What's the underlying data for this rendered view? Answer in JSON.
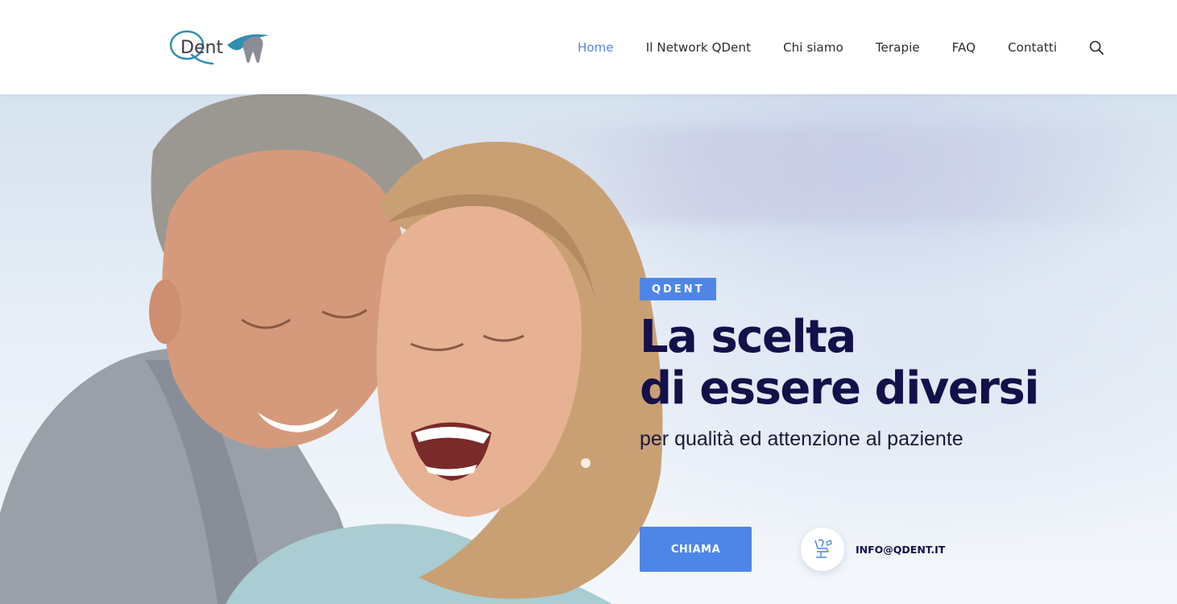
{
  "colors": {
    "accent": "#4e86e8",
    "heading": "#14104a",
    "nav_text": "#2a2a33",
    "logo_teal": "#2f8fb0"
  },
  "header": {
    "logo_text": "Dent",
    "nav": [
      {
        "label": "Home",
        "active": true
      },
      {
        "label": "Il Network QDent",
        "active": false
      },
      {
        "label": "Chi siamo",
        "active": false
      },
      {
        "label": "Terapie",
        "active": false
      },
      {
        "label": "FAQ",
        "active": false
      },
      {
        "label": "Contatti",
        "active": false
      }
    ],
    "search_icon": "search-icon"
  },
  "hero": {
    "image": "smiling-senior-couple-photo",
    "badge": "QDENT",
    "headline_line1": "La scelta",
    "headline_line2": "di essere diversi",
    "subtitle": "per qualità ed attenzione al paziente",
    "cta_label": "CHIAMA",
    "email_icon": "dental-chair-icon",
    "email": "INFO@QDENT.IT"
  }
}
